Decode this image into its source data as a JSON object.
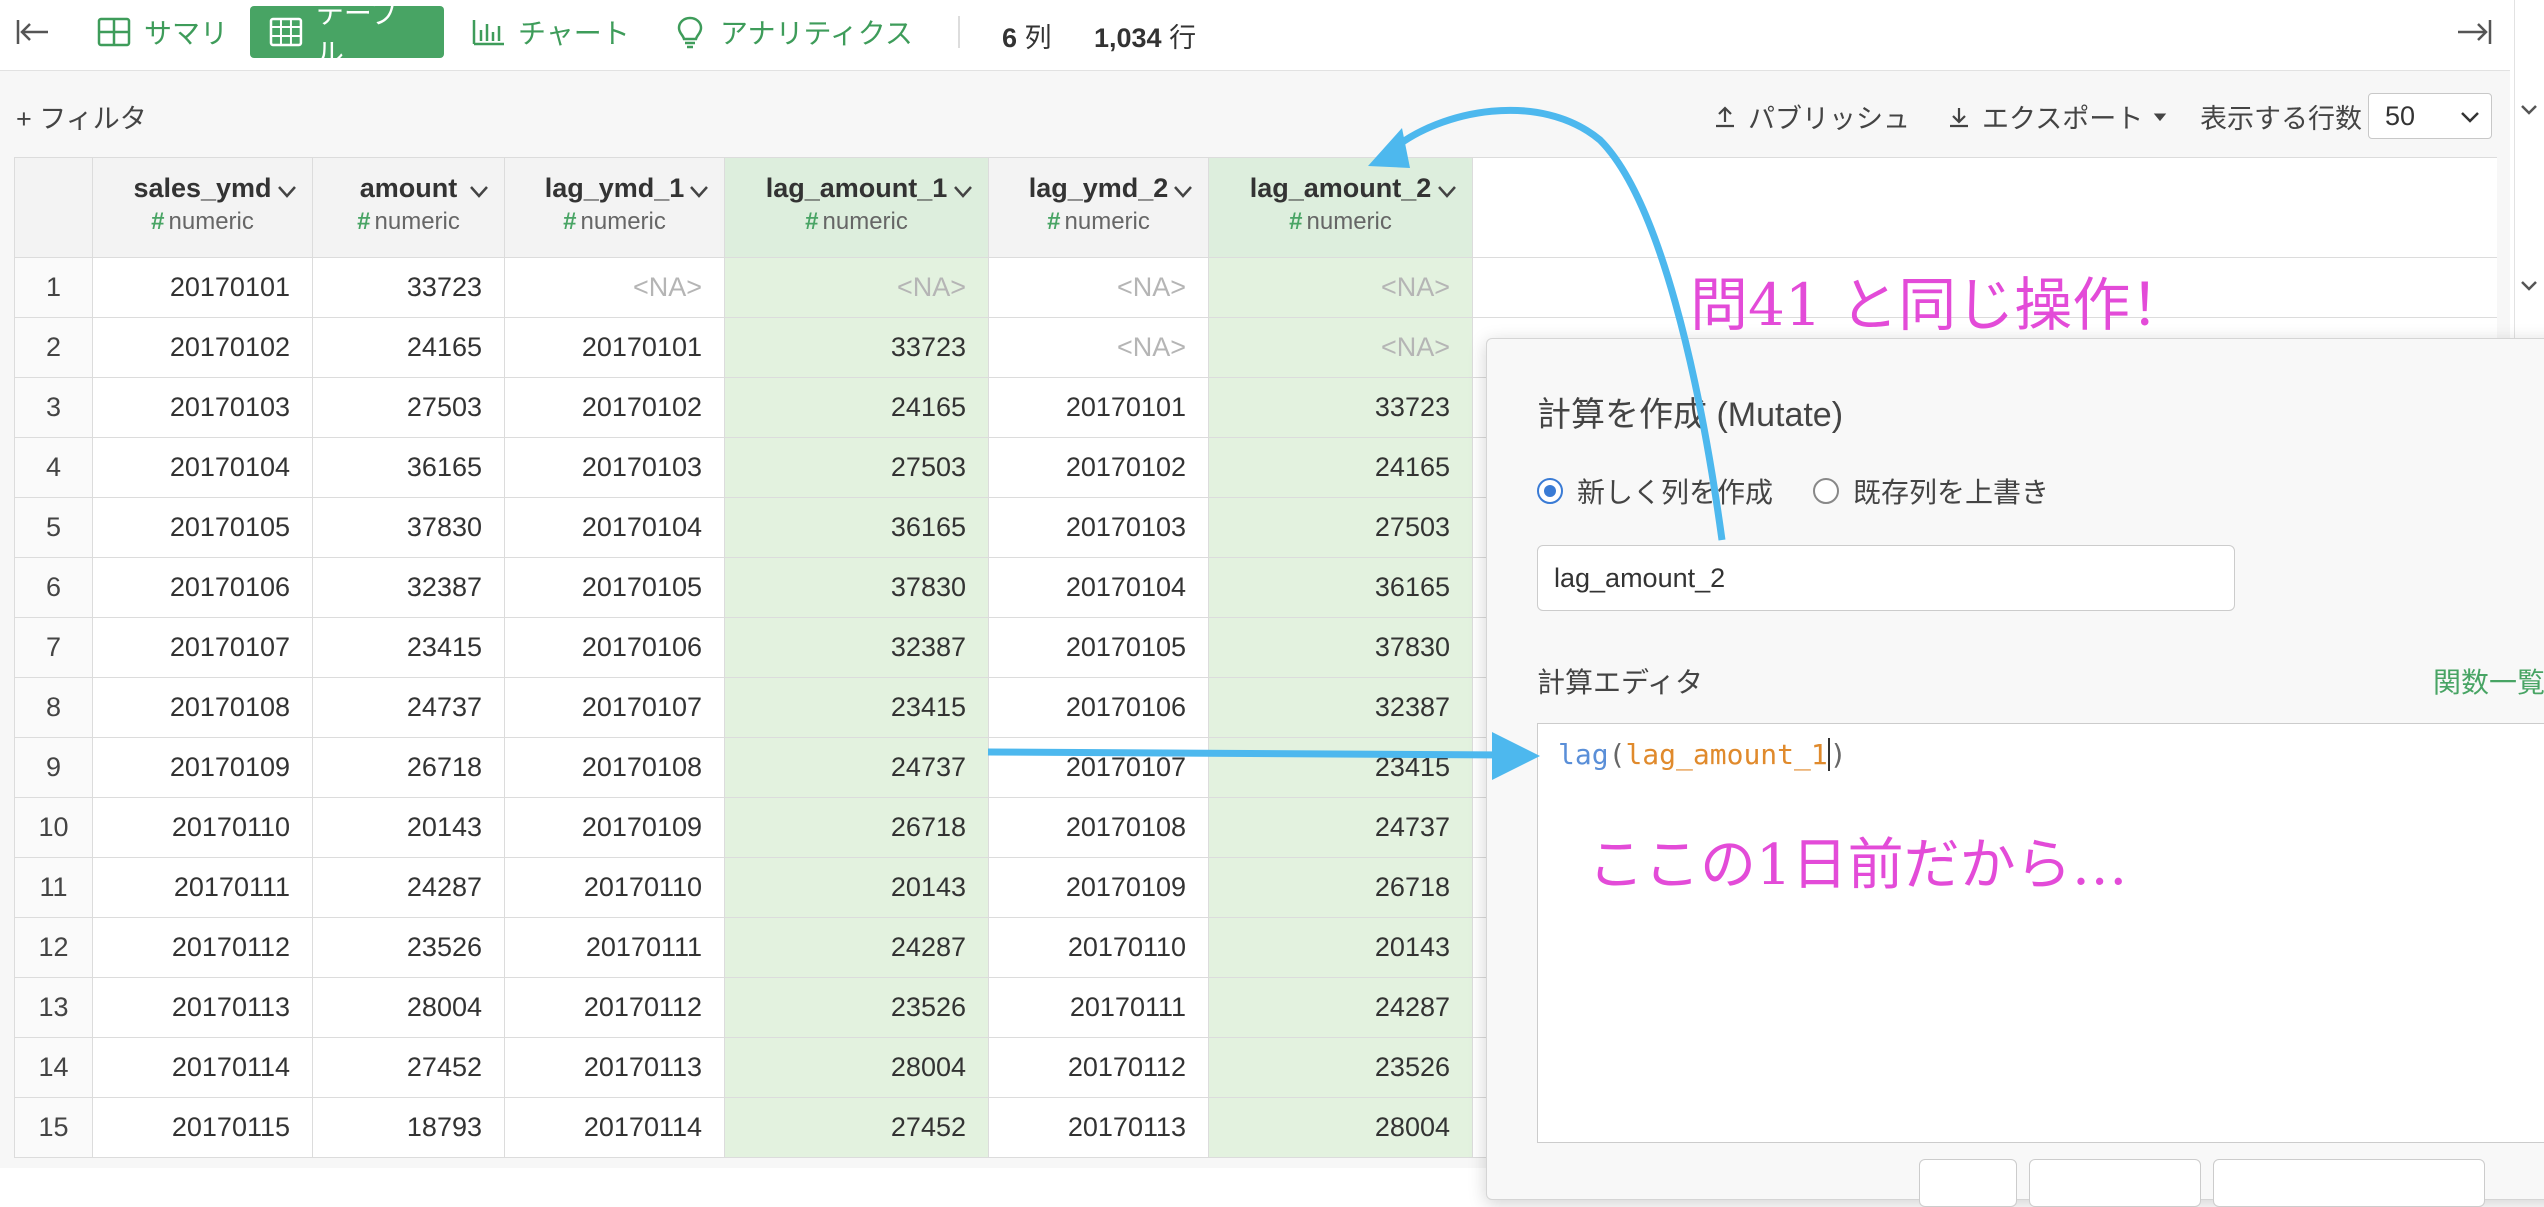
{
  "toolbar": {
    "tabs": [
      {
        "label": "サマリ",
        "icon": "summary-grid-icon",
        "active": false
      },
      {
        "label": "テーブル",
        "icon": "table-icon",
        "active": true
      },
      {
        "label": "チャート",
        "icon": "bar-chart-icon",
        "active": false
      },
      {
        "label": "アナリティクス",
        "icon": "lightbulb-icon",
        "active": false
      }
    ],
    "columns_count": "6",
    "columns_unit": "列",
    "rows_count": "1,034",
    "rows_unit": "行"
  },
  "subbar": {
    "filter_label": "+ フィルタ",
    "publish_label": "パブリッシュ",
    "export_label": "エクスポート",
    "rows_label": "表示する行数",
    "rows_value": "50"
  },
  "table": {
    "columns": [
      {
        "name": "sales_ymd",
        "type": "numeric",
        "highlight": false
      },
      {
        "name": "amount",
        "type": "numeric",
        "highlight": false
      },
      {
        "name": "lag_ymd_1",
        "type": "numeric",
        "highlight": false
      },
      {
        "name": "lag_amount_1",
        "type": "numeric",
        "highlight": true
      },
      {
        "name": "lag_ymd_2",
        "type": "numeric",
        "highlight": false
      },
      {
        "name": "lag_amount_2",
        "type": "numeric",
        "highlight": true
      }
    ],
    "rows": [
      [
        "1",
        "20170101",
        "33723",
        "<NA>",
        "<NA>",
        "<NA>",
        "<NA>"
      ],
      [
        "2",
        "20170102",
        "24165",
        "20170101",
        "33723",
        "<NA>",
        "<NA>"
      ],
      [
        "3",
        "20170103",
        "27503",
        "20170102",
        "24165",
        "20170101",
        "33723"
      ],
      [
        "4",
        "20170104",
        "36165",
        "20170103",
        "27503",
        "20170102",
        "24165"
      ],
      [
        "5",
        "20170105",
        "37830",
        "20170104",
        "36165",
        "20170103",
        "27503"
      ],
      [
        "6",
        "20170106",
        "32387",
        "20170105",
        "37830",
        "20170104",
        "36165"
      ],
      [
        "7",
        "20170107",
        "23415",
        "20170106",
        "32387",
        "20170105",
        "37830"
      ],
      [
        "8",
        "20170108",
        "24737",
        "20170107",
        "23415",
        "20170106",
        "32387"
      ],
      [
        "9",
        "20170109",
        "26718",
        "20170108",
        "24737",
        "20170107",
        "23415"
      ],
      [
        "10",
        "20170110",
        "20143",
        "20170109",
        "26718",
        "20170108",
        "24737"
      ],
      [
        "11",
        "20170111",
        "24287",
        "20170110",
        "20143",
        "20170109",
        "26718"
      ],
      [
        "12",
        "20170112",
        "23526",
        "20170111",
        "24287",
        "20170110",
        "20143"
      ],
      [
        "13",
        "20170113",
        "28004",
        "20170112",
        "23526",
        "20170111",
        "24287"
      ],
      [
        "14",
        "20170114",
        "27452",
        "20170113",
        "28004",
        "20170112",
        "23526"
      ],
      [
        "15",
        "20170115",
        "18793",
        "20170114",
        "27452",
        "20170113",
        "28004"
      ]
    ]
  },
  "dialog": {
    "title": "計算を作成 (Mutate)",
    "radio_new": "新しく列を作成",
    "radio_overwrite": "既存列を上書き",
    "new_column_name": "lag_amount_2",
    "editor_label": "計算エディタ",
    "functions_link": "関数一覧",
    "code_fn": "lag",
    "code_arg": "lag_amount_1"
  },
  "annotations": {
    "note_top": "問41 と同じ操作！",
    "note_editor": "ここの1日前だから…",
    "color": "#e34bd8",
    "arrow_color": "#4db8ee"
  }
}
